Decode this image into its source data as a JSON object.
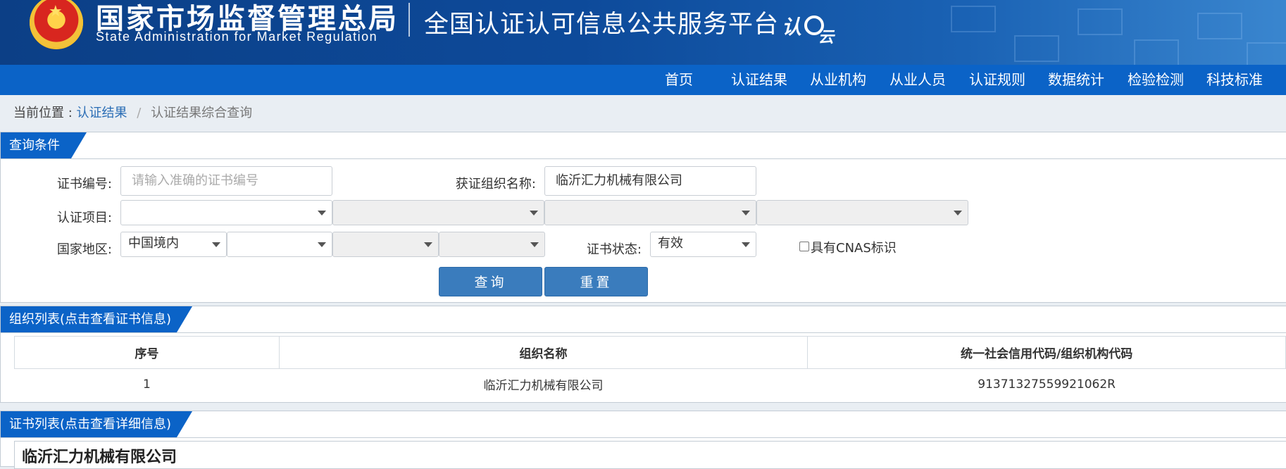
{
  "header": {
    "agency_cn": "国家市场监督管理总局",
    "agency_en": "State Administration  for  Market Regulation",
    "platform": "全国认证认可信息公共服务平台",
    "logo_text": "认e云"
  },
  "nav": {
    "items": [
      "首页",
      "认证结果",
      "从业机构",
      "从业人员",
      "认证规则",
      "数据统计",
      "检验检测",
      "科技标准"
    ]
  },
  "breadcrumb": {
    "prefix": "当前位置 :",
    "link": "认证结果",
    "separator": "/",
    "current": "认证结果综合查询"
  },
  "query": {
    "tab_title": "查询条件",
    "cert_no_label": "证书编号:",
    "cert_no_placeholder": "请输入准确的证书编号",
    "org_name_label": "获证组织名称:",
    "org_name_value": "临沂汇力机械有限公司",
    "project_label": "认证项目:",
    "region_label": "国家地区:",
    "region_value": "中国境内",
    "status_label": "证书状态:",
    "status_value": "有效",
    "cnas_label": "具有CNAS标识",
    "search_button": "查询",
    "reset_button": "重置"
  },
  "org_list": {
    "tab_title": "组织列表(点击查看证书信息)",
    "columns": [
      "序号",
      "组织名称",
      "统一社会信用代码/组织机构代码"
    ],
    "rows": [
      [
        "1",
        "临沂汇力机械有限公司",
        "91371327559921062R"
      ]
    ]
  },
  "cert_list": {
    "tab_title": "证书列表(点击查看详细信息)",
    "org_title": "临沂汇力机械有限公司"
  },
  "colors": {
    "header_blue": "#0c3f86",
    "nav_blue": "#0b63c7",
    "button_blue": "#3a7cbd",
    "link_blue": "#2a6db5"
  }
}
